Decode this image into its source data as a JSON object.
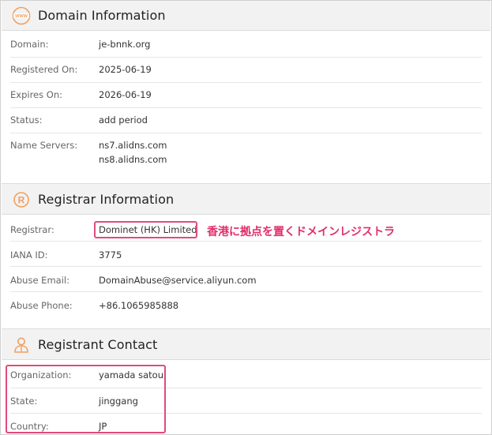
{
  "domain_section": {
    "title": "Domain Information",
    "icon": "www-globe-icon",
    "rows": [
      {
        "label": "Domain:",
        "value": "je-bnnk.org"
      },
      {
        "label": "Registered On:",
        "value": "2025-06-19"
      },
      {
        "label": "Expires On:",
        "value": "2026-06-19"
      },
      {
        "label": "Status:",
        "value": "add period"
      },
      {
        "label": "Name Servers:",
        "values": [
          "ns7.alidns.com",
          "ns8.alidns.com"
        ]
      }
    ]
  },
  "registrar_section": {
    "title": "Registrar Information",
    "icon": "registered-icon",
    "rows": [
      {
        "label": "Registrar:",
        "value": "Dominet (HK) Limited"
      },
      {
        "label": "IANA ID:",
        "value": "3775"
      },
      {
        "label": "Abuse Email:",
        "value": "DomainAbuse@service.aliyun.com"
      },
      {
        "label": "Abuse Phone:",
        "value": "+86.1065985888"
      }
    ],
    "annotation": "香港に拠点を置くドメインレジストラ"
  },
  "registrant_section": {
    "title": "Registrant Contact",
    "icon": "person-icon",
    "rows": [
      {
        "label": "Organization:",
        "value": "yamada satou"
      },
      {
        "label": "State:",
        "value": "jinggang"
      },
      {
        "label": "Country:",
        "value": "JP"
      }
    ]
  },
  "colors": {
    "accent_orange": "#f0a060",
    "highlight_pink": "#e04b7a",
    "annotation_pink": "#e0306a"
  }
}
